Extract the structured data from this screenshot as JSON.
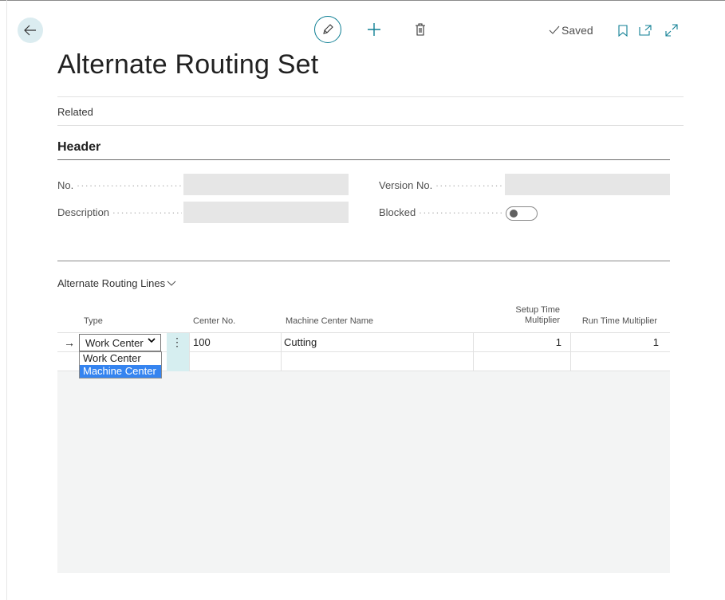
{
  "toolbar": {
    "back_icon": "arrow-left-icon",
    "edit_icon": "pencil-icon",
    "new_icon": "plus-icon",
    "delete_icon": "trash-icon",
    "saved_label": "Saved",
    "bookmark_icon": "bookmark-icon",
    "open_new_window_icon": "open-in-new-icon",
    "expand_icon": "expand-icon",
    "accent_color": "#0f7f94"
  },
  "page": {
    "title": "Alternate Routing Set",
    "related_label": "Related"
  },
  "header_section": {
    "title": "Header",
    "fields": {
      "no_label": "No.",
      "no_value": "",
      "description_label": "Description",
      "description_value": "",
      "version_label": "Version No.",
      "version_value": "",
      "blocked_label": "Blocked",
      "blocked_value": false
    }
  },
  "lines": {
    "title": "Alternate Routing Lines",
    "columns": {
      "type": "Type",
      "center_no": "Center No.",
      "machine_center_name": "Machine Center Name",
      "setup_time_1": "Setup Time",
      "setup_time_2": "Multiplier",
      "run_time": "Run Time Multiplier"
    },
    "rows": [
      {
        "type": "Work Center",
        "center_no": "100",
        "machine_center_name": "Cutting",
        "setup_time_multiplier": "1",
        "run_time_multiplier": "1"
      }
    ],
    "type_options": [
      "Work Center",
      "Machine Center"
    ],
    "highlighted_option": "Machine Center"
  }
}
